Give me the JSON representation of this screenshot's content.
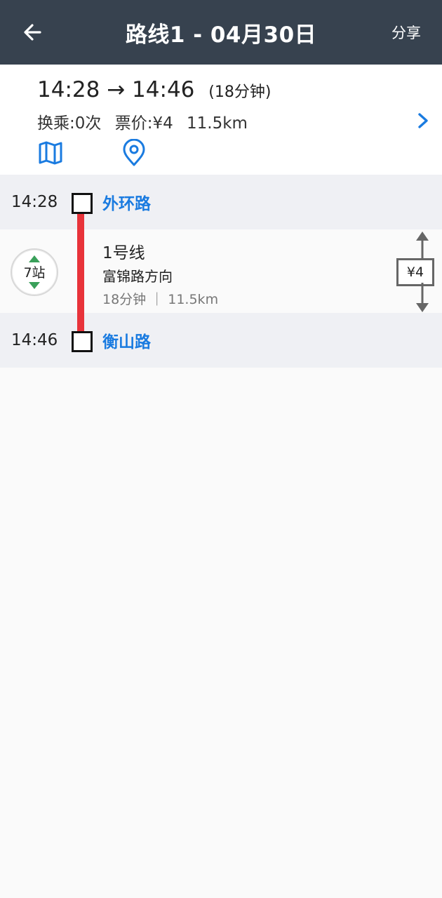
{
  "appbar": {
    "title": "路线1 - 04月30日",
    "share_label": "分享"
  },
  "summary": {
    "departure": "14:28",
    "arrow": "→",
    "arrival": "14:46",
    "duration": "(18分钟)",
    "transfers": "换乘:0次",
    "fare": "票价:¥4",
    "distance": "11.5km"
  },
  "stations": {
    "start": {
      "time": "14:28",
      "name": "外环路"
    },
    "end": {
      "time": "14:46",
      "name": "衡山路"
    }
  },
  "segment": {
    "stops": "7站",
    "line": "1号线",
    "direction": "富锦路方向",
    "info": "18分钟 ｜ 11.5km",
    "fare": "¥4"
  },
  "colors": {
    "appbar": "#37424f",
    "accent_blue": "#1a7be0",
    "line_red": "#e8333a",
    "stop_green": "#3aa05a"
  },
  "icons": [
    "back-arrow-icon",
    "chevron-right-icon",
    "map-icon",
    "location-pin-icon",
    "arrow-up-icon",
    "arrow-down-icon"
  ]
}
